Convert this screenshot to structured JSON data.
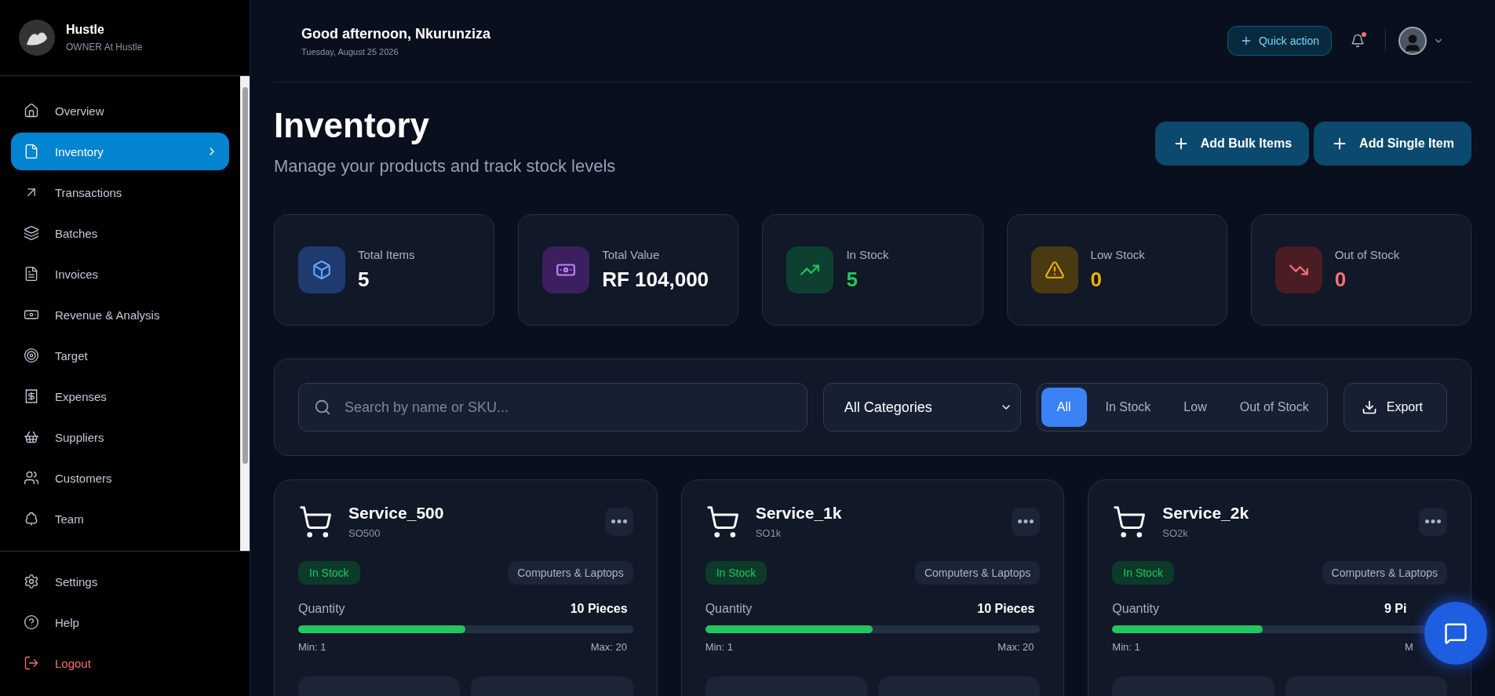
{
  "sidebar": {
    "brand": {
      "name": "Hustle",
      "role": "OWNER At Hustle"
    },
    "items": [
      {
        "label": "Overview",
        "selected": false
      },
      {
        "label": "Inventory",
        "selected": true
      },
      {
        "label": "Transactions",
        "selected": false
      },
      {
        "label": "Batches",
        "selected": false
      },
      {
        "label": "Invoices",
        "selected": false
      },
      {
        "label": "Revenue & Analysis",
        "selected": false
      },
      {
        "label": "Target",
        "selected": false
      },
      {
        "label": "Expenses",
        "selected": false
      },
      {
        "label": "Suppliers",
        "selected": false
      },
      {
        "label": "Customers",
        "selected": false
      },
      {
        "label": "Team",
        "selected": false
      }
    ],
    "footer": [
      {
        "label": "Settings",
        "kind": "normal"
      },
      {
        "label": "Help",
        "kind": "normal"
      },
      {
        "label": "Logout",
        "kind": "danger"
      }
    ]
  },
  "header": {
    "greeting": "Good afternoon, Nkurunziza",
    "date": "Tuesday, August 25 2026",
    "quick_action": "Quick action",
    "notification": true
  },
  "page": {
    "title": "Inventory",
    "subtitle": "Manage your products and track stock levels",
    "actions": [
      "Add Bulk Items",
      "Add Single Item"
    ]
  },
  "stats": [
    {
      "label": "Total Items",
      "value": "5",
      "color": "#ffffff"
    },
    {
      "label": "Total Value",
      "value": "RF 104,000",
      "color": "#ffffff"
    },
    {
      "label": "In Stock",
      "value": "5",
      "color": "#22c55e"
    },
    {
      "label": "Low Stock",
      "value": "0",
      "color": "#eab308"
    },
    {
      "label": "Out of Stock",
      "value": "0",
      "color": "#f87171"
    }
  ],
  "filters": {
    "search_placeholder": "Search by name or SKU...",
    "category": "All Categories",
    "tabs": [
      {
        "label": "All",
        "selected": true
      },
      {
        "label": "In Stock",
        "selected": false
      },
      {
        "label": "Low",
        "selected": false
      },
      {
        "label": "Out of Stock",
        "selected": false
      }
    ],
    "export": "Export"
  },
  "products": [
    {
      "name": "Service_500",
      "sku": "SO500",
      "status": "In Stock",
      "category": "Computers & Laptops",
      "quantity_label": "Quantity",
      "quantity": "10 Pieces",
      "level": 0.5,
      "min": "Min: 1",
      "max": "Max: 20"
    },
    {
      "name": "Service_1k",
      "sku": "SO1k",
      "status": "In Stock",
      "category": "Computers & Laptops",
      "quantity_label": "Quantity",
      "quantity": "10 Pieces",
      "level": 0.5,
      "min": "Min: 1",
      "max": "Max: 20"
    },
    {
      "name": "Service_2k",
      "sku": "SO2k",
      "status": "In Stock",
      "category": "Computers & Laptops",
      "quantity_label": "Quantity",
      "quantity": "9 Pi",
      "level": 0.45,
      "min": "Min: 1",
      "max": "M"
    }
  ]
}
